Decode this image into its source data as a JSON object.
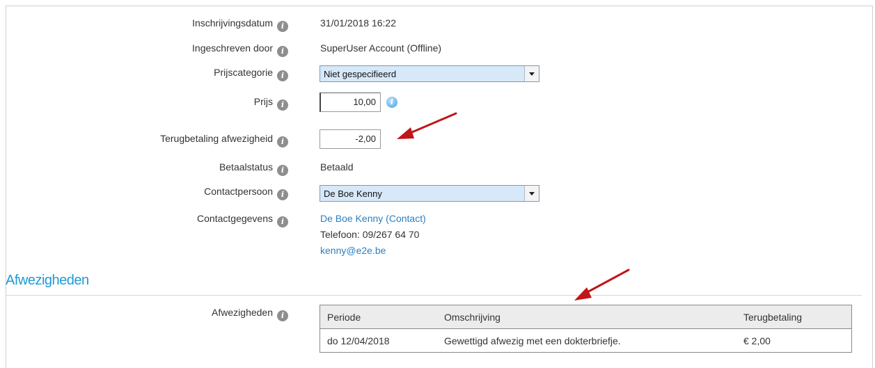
{
  "form": {
    "rows": [
      {
        "label": "Inschrijvingsdatum",
        "value": "31/01/2018 16:22"
      },
      {
        "label": "Ingeschreven door",
        "value": "SuperUser Account (Offline)"
      },
      {
        "label": "Prijscategorie",
        "select": "Niet gespecifieerd"
      },
      {
        "label": "Prijs",
        "input": "10,00"
      },
      {
        "label": "Terugbetaling afwezigheid",
        "input": "-2,00"
      },
      {
        "label": "Betaalstatus",
        "value": "Betaald"
      },
      {
        "label": "Contactpersoon",
        "select": "De Boe Kenny"
      },
      {
        "label": "Contactgegevens",
        "contact_link": "De Boe Kenny (Contact)",
        "phone": "Telefoon: 09/267 64 70",
        "email": "kenny@e2e.be"
      }
    ]
  },
  "section": {
    "title": "Afwezigheden",
    "label": "Afwezigheden",
    "table": {
      "headers": [
        "Periode",
        "Omschrijving",
        "Terugbetaling"
      ],
      "rows": [
        [
          "do 12/04/2018",
          "Gewettigd afwezig met een dokterbriefje.",
          "€ 2,00"
        ]
      ]
    }
  },
  "icons": {
    "info": "info-icon",
    "arrow": "red-arrow-annotation"
  },
  "colors": {
    "accent": "#1e9ad6",
    "link": "#2b7fc0",
    "select_bg": "#d7e8f8",
    "arrow": "#c0161b"
  }
}
